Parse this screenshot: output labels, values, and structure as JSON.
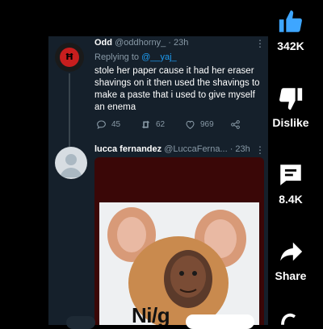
{
  "tweet1": {
    "name": "Odd",
    "handle": "@oddhorny_",
    "time": "· 23h",
    "replying_prefix": "Replying to ",
    "replying_to": "@__yaj_",
    "text": "stole her paper cause it had her eraser shavings on it then used the shavings to make a paste that i used to give myself an enema",
    "avatar_text": "Ħ",
    "replies": "45",
    "retweets": "62",
    "likes": "969"
  },
  "tweet2": {
    "name": "lucca fernandez",
    "handle": "@LuccaFerna...",
    "time": "· 23h",
    "media_caption": "Ni/g"
  },
  "rail": {
    "like_count": "342K",
    "dislike_label": "Dislike",
    "comment_count": "8.4K",
    "share_label": "Share"
  },
  "colors": {
    "twitter_bg": "#15202b",
    "muted": "#8899a6",
    "link": "#1d9bf0",
    "like_active": "#3ea6ff"
  }
}
